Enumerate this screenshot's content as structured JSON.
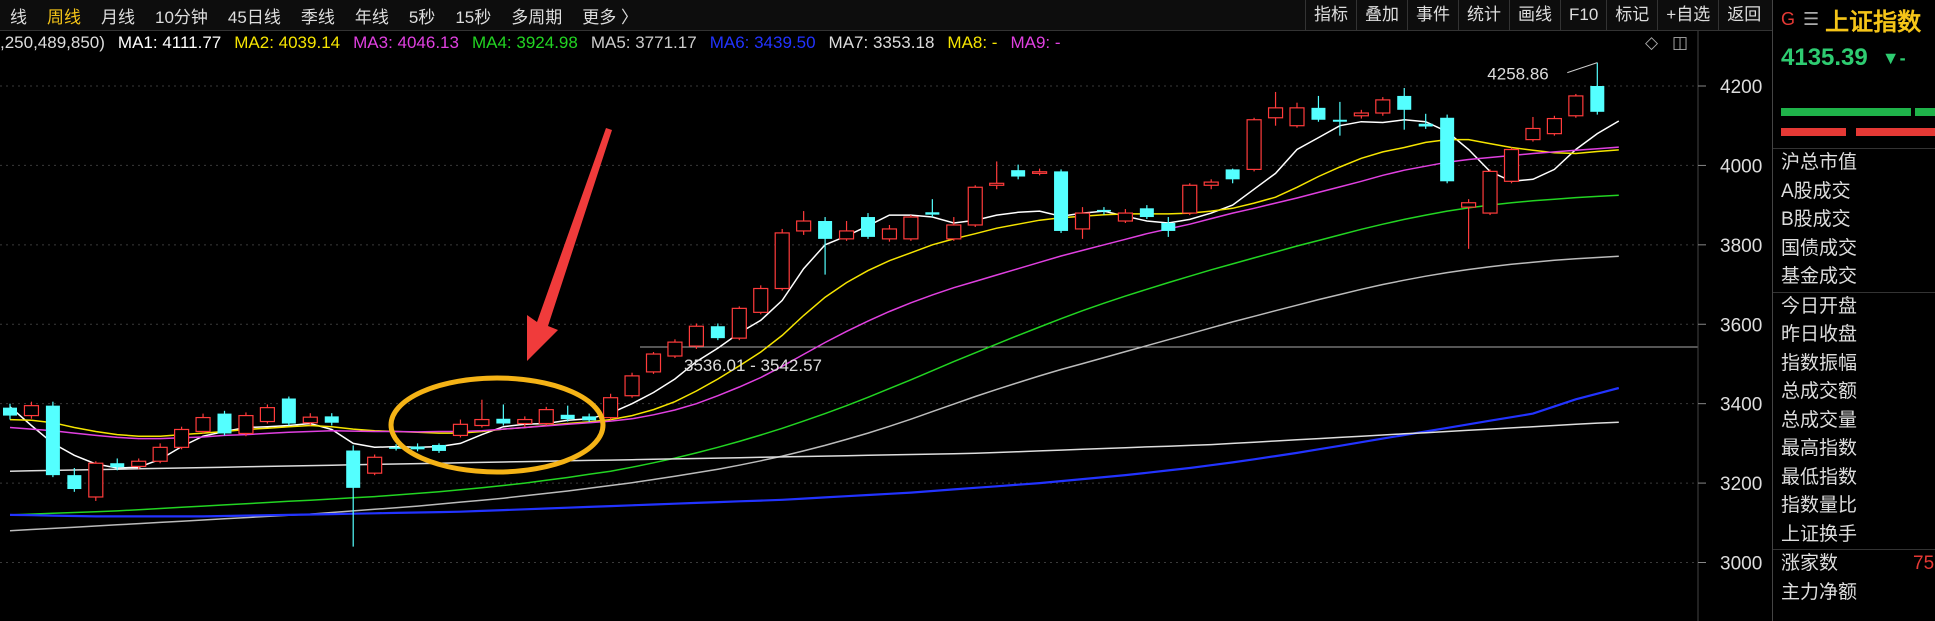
{
  "toolbar": {
    "periods": [
      "线",
      "周线",
      "月线",
      "10分钟",
      "45日线",
      "季线",
      "年线",
      "5秒",
      "15秒",
      "多周期",
      "更多 〉"
    ],
    "active_period": "周线",
    "tools": [
      "指标",
      "叠加",
      "事件",
      "统计",
      "画线",
      "F10",
      "标记",
      "+自选",
      "返回"
    ]
  },
  "legend": {
    "volume": ",250,489,850)",
    "items": [
      {
        "label": "MA1: 4111.77",
        "color": "#ffffff"
      },
      {
        "label": "MA2: 4039.14",
        "color": "#f5e400"
      },
      {
        "label": "MA3: 4046.13",
        "color": "#e040e0"
      },
      {
        "label": "MA4: 3924.98",
        "color": "#22d422"
      },
      {
        "label": "MA5: 3771.17",
        "color": "#cccccc"
      },
      {
        "label": "MA6: 3439.50",
        "color": "#2233ff"
      },
      {
        "label": "MA7: 3353.18",
        "color": "#dddddd"
      },
      {
        "label": "MA8: -",
        "color": "#f5e400"
      },
      {
        "label": "MA9: -",
        "color": "#e040e0"
      }
    ]
  },
  "panel": {
    "g_icon": "G",
    "menu_icon": "☰",
    "index_name": "上证指数",
    "price": "4135.39",
    "change_arrow": "▼",
    "change_suffix": "-",
    "items": [
      "沪总市值",
      "A股成交",
      "B股成交",
      "国债成交",
      "基金成交",
      "今日开盘",
      "昨日收盘",
      "指数振幅",
      "总成交额",
      "总成交量",
      "最高指数",
      "最低指数",
      "指数量比",
      "上证换手",
      "涨家数",
      "主力净额"
    ],
    "rise_count_partial": "75"
  },
  "chart_data": {
    "type": "candlestick",
    "y_axis": {
      "min": 2950,
      "max": 4300,
      "ticks": [
        3000,
        3200,
        3400,
        3600,
        3800,
        4000,
        4200
      ]
    },
    "annotations": {
      "high_label": "4258.86",
      "range_label": "3536.01 - 3542.57",
      "reference_level": 3542.57
    },
    "candles": [
      {
        "o": 3390,
        "c": 3370,
        "h": 3400,
        "l": 3360
      },
      {
        "o": 3370,
        "c": 3395,
        "h": 3405,
        "l": 3362
      },
      {
        "o": 3395,
        "c": 3220,
        "h": 3405,
        "l": 3215
      },
      {
        "o": 3220,
        "c": 3185,
        "h": 3238,
        "l": 3178
      },
      {
        "o": 3165,
        "c": 3250,
        "h": 3255,
        "l": 3155
      },
      {
        "o": 3250,
        "c": 3240,
        "h": 3262,
        "l": 3232
      },
      {
        "o": 3242,
        "c": 3255,
        "h": 3262,
        "l": 3235
      },
      {
        "o": 3255,
        "c": 3290,
        "h": 3300,
        "l": 3250
      },
      {
        "o": 3290,
        "c": 3335,
        "h": 3342,
        "l": 3285
      },
      {
        "o": 3330,
        "c": 3365,
        "h": 3375,
        "l": 3325
      },
      {
        "o": 3375,
        "c": 3325,
        "h": 3382,
        "l": 3320
      },
      {
        "o": 3325,
        "c": 3370,
        "h": 3378,
        "l": 3318
      },
      {
        "o": 3355,
        "c": 3390,
        "h": 3398,
        "l": 3350
      },
      {
        "o": 3413,
        "c": 3350,
        "h": 3418,
        "l": 3345
      },
      {
        "o": 3352,
        "c": 3366,
        "h": 3376,
        "l": 3345
      },
      {
        "o": 3368,
        "c": 3352,
        "h": 3376,
        "l": 3345
      },
      {
        "o": 3282,
        "c": 3188,
        "h": 3295,
        "l": 3040
      },
      {
        "o": 3225,
        "c": 3265,
        "h": 3272,
        "l": 3220
      },
      {
        "o": 3290,
        "c": 3288,
        "h": 3298,
        "l": 3282
      },
      {
        "o": 3292,
        "c": 3285,
        "h": 3300,
        "l": 3280
      },
      {
        "o": 3296,
        "c": 3281,
        "h": 3300,
        "l": 3276
      },
      {
        "o": 3320,
        "c": 3348,
        "h": 3360,
        "l": 3315
      },
      {
        "o": 3345,
        "c": 3360,
        "h": 3410,
        "l": 3340
      },
      {
        "o": 3362,
        "c": 3350,
        "h": 3398,
        "l": 3345
      },
      {
        "o": 3350,
        "c": 3360,
        "h": 3368,
        "l": 3342
      },
      {
        "o": 3350,
        "c": 3385,
        "h": 3392,
        "l": 3345
      },
      {
        "o": 3372,
        "c": 3361,
        "h": 3395,
        "l": 3355
      },
      {
        "o": 3368,
        "c": 3358,
        "h": 3375,
        "l": 3354
      },
      {
        "o": 3365,
        "c": 3415,
        "h": 3425,
        "l": 3360
      },
      {
        "o": 3420,
        "c": 3470,
        "h": 3478,
        "l": 3415
      },
      {
        "o": 3480,
        "c": 3525,
        "h": 3530,
        "l": 3475
      },
      {
        "o": 3520,
        "c": 3555,
        "h": 3562,
        "l": 3515
      },
      {
        "o": 3545,
        "c": 3595,
        "h": 3602,
        "l": 3538
      },
      {
        "o": 3595,
        "c": 3565,
        "h": 3602,
        "l": 3560
      },
      {
        "o": 3565,
        "c": 3640,
        "h": 3645,
        "l": 3560
      },
      {
        "o": 3630,
        "c": 3690,
        "h": 3698,
        "l": 3625
      },
      {
        "o": 3690,
        "c": 3830,
        "h": 3840,
        "l": 3685
      },
      {
        "o": 3835,
        "c": 3860,
        "h": 3885,
        "l": 3825
      },
      {
        "o": 3860,
        "c": 3815,
        "h": 3870,
        "l": 3725
      },
      {
        "o": 3815,
        "c": 3835,
        "h": 3860,
        "l": 3810
      },
      {
        "o": 3870,
        "c": 3820,
        "h": 3880,
        "l": 3815
      },
      {
        "o": 3815,
        "c": 3840,
        "h": 3850,
        "l": 3808
      },
      {
        "o": 3815,
        "c": 3870,
        "h": 3875,
        "l": 3810
      },
      {
        "o": 3882,
        "c": 3876,
        "h": 3915,
        "l": 3870
      },
      {
        "o": 3815,
        "c": 3850,
        "h": 3870,
        "l": 3810
      },
      {
        "o": 3850,
        "c": 3945,
        "h": 3950,
        "l": 3845
      },
      {
        "o": 3950,
        "c": 3955,
        "h": 4010,
        "l": 3940
      },
      {
        "o": 3988,
        "c": 3972,
        "h": 4002,
        "l": 3965
      },
      {
        "o": 3980,
        "c": 3984,
        "h": 3992,
        "l": 3975
      },
      {
        "o": 3985,
        "c": 3835,
        "h": 3990,
        "l": 3830
      },
      {
        "o": 3840,
        "c": 3880,
        "h": 3895,
        "l": 3815
      },
      {
        "o": 3888,
        "c": 3884,
        "h": 3895,
        "l": 3876
      },
      {
        "o": 3860,
        "c": 3880,
        "h": 3890,
        "l": 3855
      },
      {
        "o": 3892,
        "c": 3870,
        "h": 3900,
        "l": 3865
      },
      {
        "o": 3855,
        "c": 3835,
        "h": 3870,
        "l": 3820
      },
      {
        "o": 3880,
        "c": 3950,
        "h": 3955,
        "l": 3875
      },
      {
        "o": 3950,
        "c": 3958,
        "h": 3965,
        "l": 3940
      },
      {
        "o": 3990,
        "c": 3965,
        "h": 3992,
        "l": 3955
      },
      {
        "o": 3990,
        "c": 4115,
        "h": 4120,
        "l": 3985
      },
      {
        "o": 4120,
        "c": 4145,
        "h": 4185,
        "l": 4100
      },
      {
        "o": 4100,
        "c": 4145,
        "h": 4158,
        "l": 4095
      },
      {
        "o": 4145,
        "c": 4115,
        "h": 4175,
        "l": 4110
      },
      {
        "o": 4115,
        "c": 4110,
        "h": 4160,
        "l": 4075
      },
      {
        "o": 4125,
        "c": 4132,
        "h": 4140,
        "l": 4118
      },
      {
        "o": 4132,
        "c": 4165,
        "h": 4172,
        "l": 4125
      },
      {
        "o": 4175,
        "c": 4140,
        "h": 4195,
        "l": 4090
      },
      {
        "o": 4105,
        "c": 4098,
        "h": 4130,
        "l": 4092
      },
      {
        "o": 4120,
        "c": 3960,
        "h": 4128,
        "l": 3955
      },
      {
        "o": 3895,
        "c": 3906,
        "h": 3915,
        "l": 3790
      },
      {
        "o": 3880,
        "c": 3985,
        "h": 3990,
        "l": 3875
      },
      {
        "o": 3960,
        "c": 4040,
        "h": 4045,
        "l": 3955
      },
      {
        "o": 4065,
        "c": 4093,
        "h": 4122,
        "l": 4060
      },
      {
        "o": 4080,
        "c": 4118,
        "h": 4125,
        "l": 4075
      },
      {
        "o": 4125,
        "c": 4175,
        "h": 4180,
        "l": 4120
      },
      {
        "o": 4200,
        "c": 4135,
        "h": 4258.86,
        "l": 4128
      }
    ],
    "series": [
      {
        "name": "MA1",
        "color": "#ffffff",
        "values": [
          3392,
          3345,
          3300,
          3270,
          3248,
          3238,
          3240,
          3260,
          3292,
          3318,
          3330,
          3340,
          3342,
          3345,
          3350,
          3335,
          3300,
          3290,
          3292,
          3290,
          3292,
          3300,
          3322,
          3342,
          3348,
          3350,
          3358,
          3362,
          3376,
          3400,
          3428,
          3462,
          3506,
          3540,
          3578,
          3610,
          3660,
          3740,
          3800,
          3822,
          3848,
          3875,
          3875,
          3870,
          3855,
          3862,
          3875,
          3882,
          3885,
          3872,
          3880,
          3885,
          3872,
          3860,
          3855,
          3864,
          3880,
          3900,
          3940,
          3980,
          4040,
          4070,
          4100,
          4110,
          4108,
          4115,
          4110,
          4085,
          4040,
          3985,
          3960,
          3965,
          3990,
          4040,
          4080,
          4111.77
        ]
      },
      {
        "name": "MA2",
        "color": "#f5e400",
        "values": [
          3360,
          3358,
          3352,
          3340,
          3330,
          3322,
          3318,
          3318,
          3322,
          3326,
          3330,
          3335,
          3338,
          3342,
          3345,
          3342,
          3336,
          3332,
          3330,
          3328,
          3326,
          3326,
          3330,
          3336,
          3340,
          3345,
          3350,
          3354,
          3360,
          3370,
          3385,
          3405,
          3432,
          3462,
          3495,
          3530,
          3572,
          3622,
          3668,
          3705,
          3735,
          3760,
          3780,
          3800,
          3815,
          3828,
          3842,
          3852,
          3862,
          3868,
          3872,
          3876,
          3878,
          3878,
          3878,
          3880,
          3885,
          3892,
          3905,
          3920,
          3945,
          3972,
          3996,
          4018,
          4034,
          4045,
          4058,
          4065,
          4065,
          4055,
          4045,
          4038,
          4032,
          4030,
          4035,
          4039.14
        ]
      },
      {
        "name": "MA3",
        "color": "#e040e0",
        "values": [
          3340,
          3336,
          3332,
          3326,
          3320,
          3315,
          3312,
          3312,
          3314,
          3316,
          3320,
          3322,
          3325,
          3328,
          3330,
          3332,
          3331,
          3330,
          3330,
          3329,
          3330,
          3330,
          3332,
          3336,
          3340,
          3344,
          3348,
          3352,
          3356,
          3362,
          3372,
          3384,
          3400,
          3420,
          3442,
          3466,
          3494,
          3524,
          3554,
          3582,
          3608,
          3632,
          3654,
          3674,
          3692,
          3708,
          3724,
          3740,
          3756,
          3772,
          3786,
          3800,
          3814,
          3828,
          3840,
          3852,
          3866,
          3880,
          3892,
          3905,
          3918,
          3932,
          3946,
          3960,
          3975,
          3988,
          3998,
          4008,
          4015,
          4020,
          4025,
          4030,
          4034,
          4038,
          4042,
          4046.13
        ]
      },
      {
        "name": "MA4",
        "color": "#22d422",
        "values": [
          3120,
          3122,
          3124,
          3126,
          3128,
          3130,
          3133,
          3136,
          3139,
          3142,
          3145,
          3148,
          3151,
          3154,
          3157,
          3160,
          3163,
          3166,
          3170,
          3174,
          3178,
          3183,
          3188,
          3194,
          3200,
          3207,
          3214,
          3222,
          3230,
          3240,
          3251,
          3263,
          3276,
          3290,
          3305,
          3321,
          3338,
          3356,
          3375,
          3395,
          3416,
          3438,
          3460,
          3483,
          3506,
          3528,
          3550,
          3572,
          3593,
          3614,
          3634,
          3653,
          3671,
          3688,
          3705,
          3721,
          3737,
          3752,
          3767,
          3782,
          3797,
          3811,
          3825,
          3839,
          3852,
          3864,
          3875,
          3885,
          3893,
          3900,
          3906,
          3911,
          3915,
          3919,
          3922,
          3924.98
        ]
      },
      {
        "name": "MA5",
        "color": "#bbbbbb",
        "values": [
          3080,
          3083,
          3086,
          3089,
          3092,
          3095,
          3098,
          3101,
          3104,
          3107,
          3110,
          3113,
          3116,
          3119,
          3122,
          3126,
          3130,
          3134,
          3138,
          3142,
          3147,
          3152,
          3157,
          3162,
          3168,
          3174,
          3180,
          3187,
          3194,
          3201,
          3209,
          3217,
          3226,
          3235,
          3245,
          3256,
          3268,
          3281,
          3295,
          3310,
          3326,
          3343,
          3361,
          3380,
          3399,
          3418,
          3436,
          3453,
          3470,
          3486,
          3501,
          3516,
          3531,
          3546,
          3561,
          3576,
          3591,
          3606,
          3620,
          3634,
          3648,
          3662,
          3675,
          3688,
          3700,
          3711,
          3721,
          3730,
          3738,
          3745,
          3751,
          3756,
          3761,
          3765,
          3768,
          3771.17
        ]
      },
      {
        "name": "MA6",
        "color": "#2233ff",
        "values": [
          3120,
          3119,
          3118,
          3117,
          3116,
          3116,
          3116,
          3116,
          3116,
          3116,
          3117,
          3118,
          3119,
          3120,
          3121,
          3122,
          3123,
          3124,
          3125,
          3126,
          3127,
          3128,
          3130,
          3132,
          3134,
          3136,
          3138,
          3140,
          3142,
          3144,
          3146,
          3148,
          3150,
          3152,
          3154,
          3156,
          3158,
          3161,
          3164,
          3167,
          3170,
          3173,
          3176,
          3180,
          3184,
          3188,
          3192,
          3196,
          3200,
          3205,
          3210,
          3215,
          3220,
          3226,
          3232,
          3238,
          3245,
          3252,
          3260,
          3268,
          3276,
          3285,
          3294,
          3303,
          3312,
          3321,
          3330,
          3339,
          3348,
          3357,
          3366,
          3375,
          3393,
          3411,
          3425,
          3439.5
        ]
      },
      {
        "name": "MA7",
        "color": "#dddddd",
        "values": [
          3230,
          3231,
          3232,
          3233,
          3234,
          3235,
          3236,
          3237,
          3238,
          3239,
          3240,
          3241,
          3242,
          3243,
          3244,
          3245,
          3246,
          3247,
          3248,
          3249,
          3250,
          3251,
          3252,
          3253,
          3254,
          3255,
          3256,
          3257,
          3258,
          3259,
          3260,
          3261,
          3262,
          3263,
          3264,
          3265,
          3266,
          3267,
          3268,
          3269,
          3270,
          3271,
          3272,
          3273,
          3274,
          3275,
          3277,
          3279,
          3281,
          3283,
          3285,
          3287,
          3289,
          3291,
          3293,
          3295,
          3297,
          3300,
          3303,
          3306,
          3309,
          3312,
          3315,
          3318,
          3321,
          3324,
          3327,
          3330,
          3333,
          3336,
          3339,
          3342,
          3345,
          3348,
          3351,
          3353.18
        ]
      }
    ]
  }
}
